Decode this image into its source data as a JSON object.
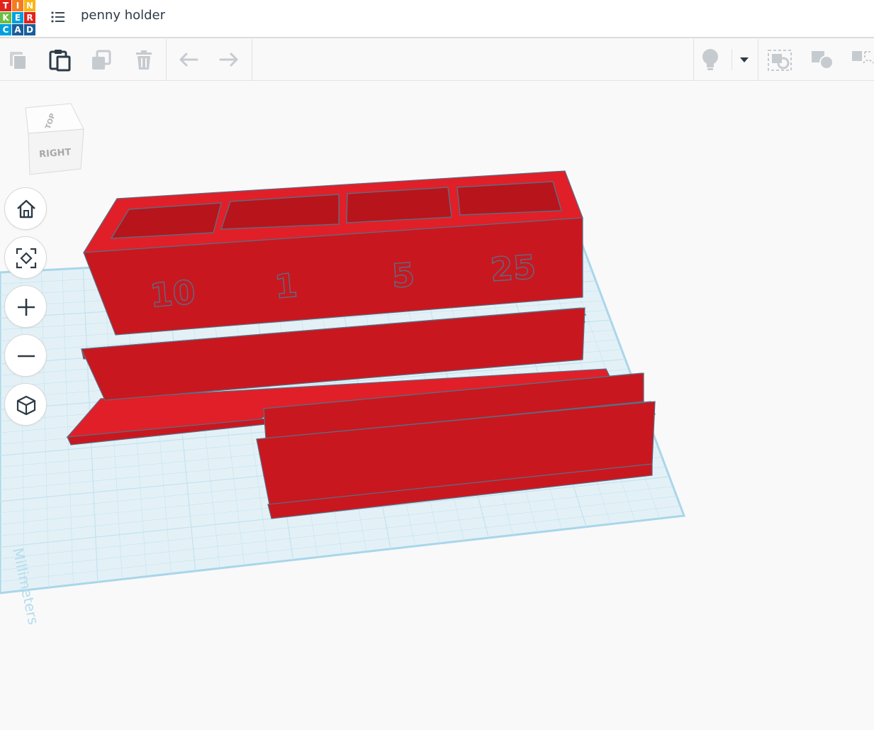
{
  "app": {
    "logo_letters": [
      "T",
      "I",
      "N",
      "K",
      "E",
      "R",
      "C",
      "A",
      "D"
    ],
    "logo_colors": [
      "#e2231a",
      "#f47b20",
      "#f9b516",
      "#6cbd45",
      "#00a0de",
      "#e2231a",
      "#00a0de",
      "#1a5e9c",
      "#1a5e9c"
    ]
  },
  "header": {
    "title": "penny holder",
    "menu_icon": "list-icon"
  },
  "toolbar": {
    "left_buttons": [
      {
        "name": "copy-button",
        "icon": "copy-icon",
        "enabled": false
      },
      {
        "name": "paste-button",
        "icon": "paste-icon",
        "enabled": true
      },
      {
        "name": "duplicate-button",
        "icon": "duplicate-icon",
        "enabled": false
      },
      {
        "name": "delete-button",
        "icon": "trash-icon",
        "enabled": false
      },
      {
        "name": "undo-button",
        "icon": "undo-arrow-icon",
        "enabled": false
      },
      {
        "name": "redo-button",
        "icon": "redo-arrow-icon",
        "enabled": false
      }
    ],
    "right_buttons": [
      {
        "name": "light-bulb-button",
        "icon": "lightbulb-icon"
      },
      {
        "name": "light-dropdown",
        "icon": "caret-down-icon"
      },
      {
        "name": "group-button",
        "icon": "group-icon"
      },
      {
        "name": "ungroup-button",
        "icon": "shapes-icon"
      },
      {
        "name": "align-button",
        "icon": "align-icon"
      }
    ]
  },
  "viewcube": {
    "top_label": "TOP",
    "front_label": "RIGHT"
  },
  "nav_controls": [
    {
      "name": "home-view-button",
      "icon": "home-icon"
    },
    {
      "name": "fit-view-button",
      "icon": "fit-view-icon"
    },
    {
      "name": "zoom-in-button",
      "icon": "plus-icon"
    },
    {
      "name": "zoom-out-button",
      "icon": "minus-icon"
    },
    {
      "name": "perspective-button",
      "icon": "cube-icon"
    }
  ],
  "workplane": {
    "unit_label": "Millimeters",
    "model_labels": [
      "10",
      "1",
      "5",
      "25"
    ],
    "colors": {
      "model_face": "#c9171f",
      "model_top": "#e11f28",
      "model_edge": "#5a6e84",
      "grid_fill": "#e3f1f7",
      "grid_border": "#a9d6ea",
      "grid_line": "#c4e2ee"
    }
  }
}
